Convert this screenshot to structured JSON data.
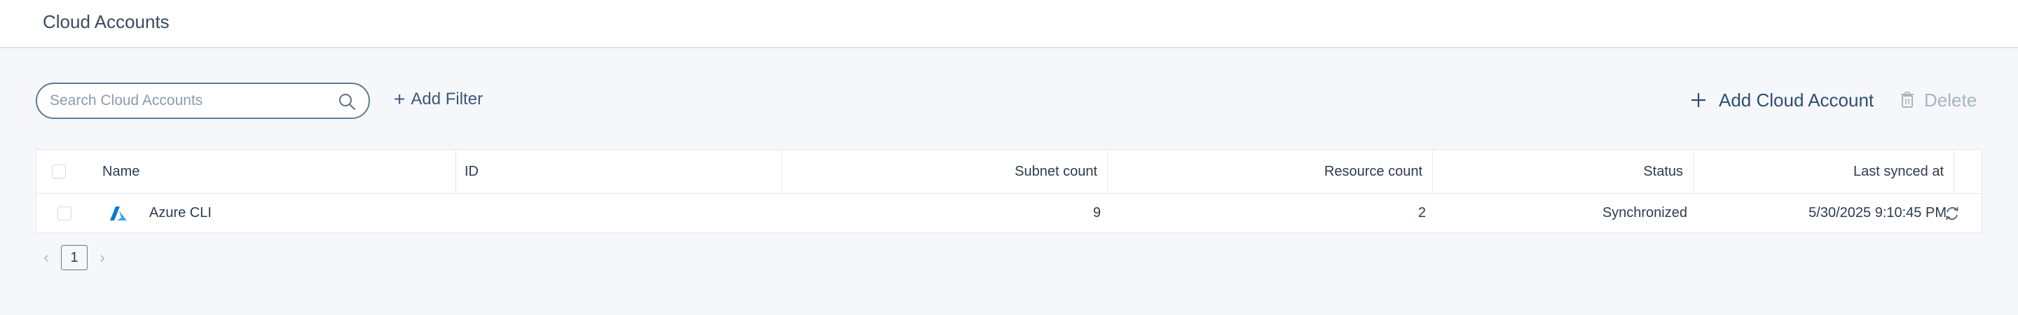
{
  "header": {
    "title": "Cloud Accounts"
  },
  "toolbar": {
    "search_placeholder": "Search Cloud Accounts",
    "search_value": "",
    "add_filter_label": "Add Filter",
    "add_account_label": "Add Cloud Account",
    "delete_label": "Delete"
  },
  "table": {
    "columns": {
      "name": "Name",
      "id": "ID",
      "subnet_count": "Subnet count",
      "resource_count": "Resource count",
      "status": "Status",
      "last_synced_at": "Last synced at"
    },
    "rows": [
      {
        "icon": "azure-logo-icon",
        "name": "Azure CLI",
        "id": "",
        "subnet_count": "9",
        "resource_count": "2",
        "status": "Synchronized",
        "last_synced_at": "5/30/2025 9:10:45 PM",
        "action_icon": "sync-icon"
      }
    ]
  },
  "pagination": {
    "current_page": "1",
    "prev_icon": "chevron-left-icon",
    "next_icon": "chevron-right-icon"
  },
  "colors": {
    "accent": "#2f4e72",
    "border": "#5d7b97",
    "background": "#f5f7fa",
    "azure": "#0a78d4"
  }
}
